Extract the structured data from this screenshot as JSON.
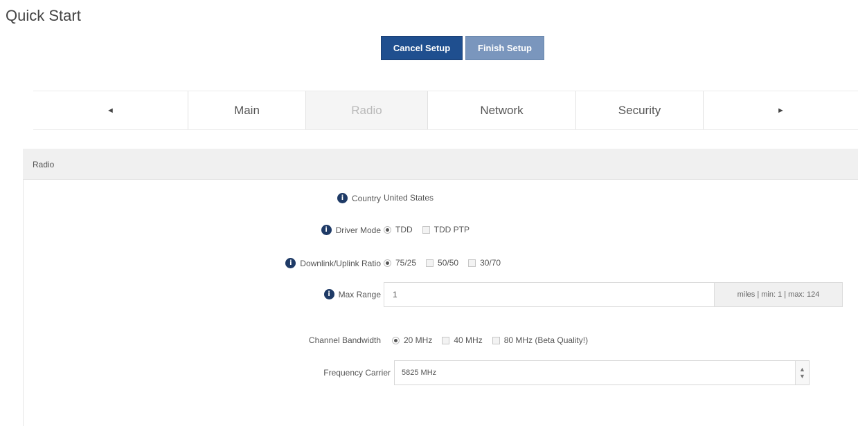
{
  "page": {
    "title": "Quick Start"
  },
  "actions": {
    "cancel_label": "Cancel Setup",
    "finish_label": "Finish Setup"
  },
  "tabs": {
    "prev": "◄",
    "next": "►",
    "items": [
      {
        "label": "Main"
      },
      {
        "label": "Radio",
        "active": true
      },
      {
        "label": "Network"
      },
      {
        "label": "Security"
      }
    ]
  },
  "panel": {
    "title": "Radio"
  },
  "form": {
    "country": {
      "label": "Country",
      "value": "United States"
    },
    "driver_mode": {
      "label": "Driver Mode",
      "options": [
        "TDD",
        "TDD PTP"
      ],
      "selected": "TDD"
    },
    "ratio": {
      "label": "Downlink/Uplink Ratio",
      "options": [
        "75/25",
        "50/50",
        "30/70"
      ],
      "selected": "75/25"
    },
    "max_range": {
      "label": "Max Range",
      "value": "1",
      "addon": "miles | min: 1 | max: 124"
    },
    "bandwidth": {
      "label": "Channel Bandwidth",
      "options": [
        "20 MHz",
        "40 MHz",
        "80 MHz (Beta Quality!)"
      ],
      "selected": "20 MHz"
    },
    "frequency": {
      "label": "Frequency Carrier",
      "value": "5825 MHz"
    }
  },
  "icons": {
    "info": "info-icon",
    "arrow_left": "arrow-left-icon",
    "arrow_right": "arrow-right-icon",
    "dropdown": "chevron-down-icon"
  },
  "colors": {
    "primary": "#1f4f8f",
    "disabled": "#7a96bd",
    "info_icon": "#1e3a66"
  }
}
